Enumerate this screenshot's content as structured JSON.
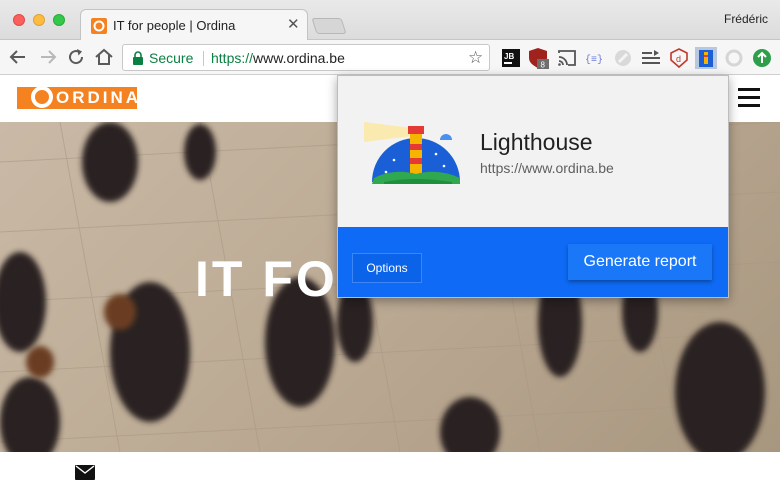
{
  "window": {
    "profile_name": "Frédéric"
  },
  "tabs": [
    {
      "title": "IT for people | Ordina",
      "close": "✕",
      "favicon": "ordina-favicon"
    }
  ],
  "toolbar": {
    "back_icon": "arrow-left-icon",
    "forward_icon": "arrow-right-icon",
    "reload_icon": "reload-icon",
    "home_icon": "home-icon",
    "secure_label": "Secure",
    "url_scheme": "https://",
    "url_host": "www.ordina.be",
    "bookmark_star": "☆",
    "extensions": [
      {
        "name": "jetbrains-ext-icon",
        "label": "JB"
      },
      {
        "name": "ublock-ext-icon",
        "badge": "8"
      },
      {
        "name": "cast-icon"
      },
      {
        "name": "json-viewer-ext-icon",
        "label": "{≡}"
      },
      {
        "name": "disabled-ext-icon"
      },
      {
        "name": "reader-list-ext-icon"
      },
      {
        "name": "d-shield-ext-icon",
        "label": "d"
      },
      {
        "name": "lighthouse-ext-icon"
      },
      {
        "name": "disabled-circle-ext-icon"
      },
      {
        "name": "green-upload-ext-icon"
      }
    ]
  },
  "site": {
    "logo_text": "ORDINA",
    "hero_text": "IT FO",
    "menu_icon": "hamburger-menu-icon",
    "footer_icon": "envelope-icon"
  },
  "popup": {
    "title": "Lighthouse",
    "url": "https://www.ordina.be",
    "options_label": "Options",
    "generate_label": "Generate report",
    "colors": {
      "action_bar": "#0f6bf5",
      "button": "#1a77f8",
      "header_bg": "#f2f2f2"
    }
  }
}
